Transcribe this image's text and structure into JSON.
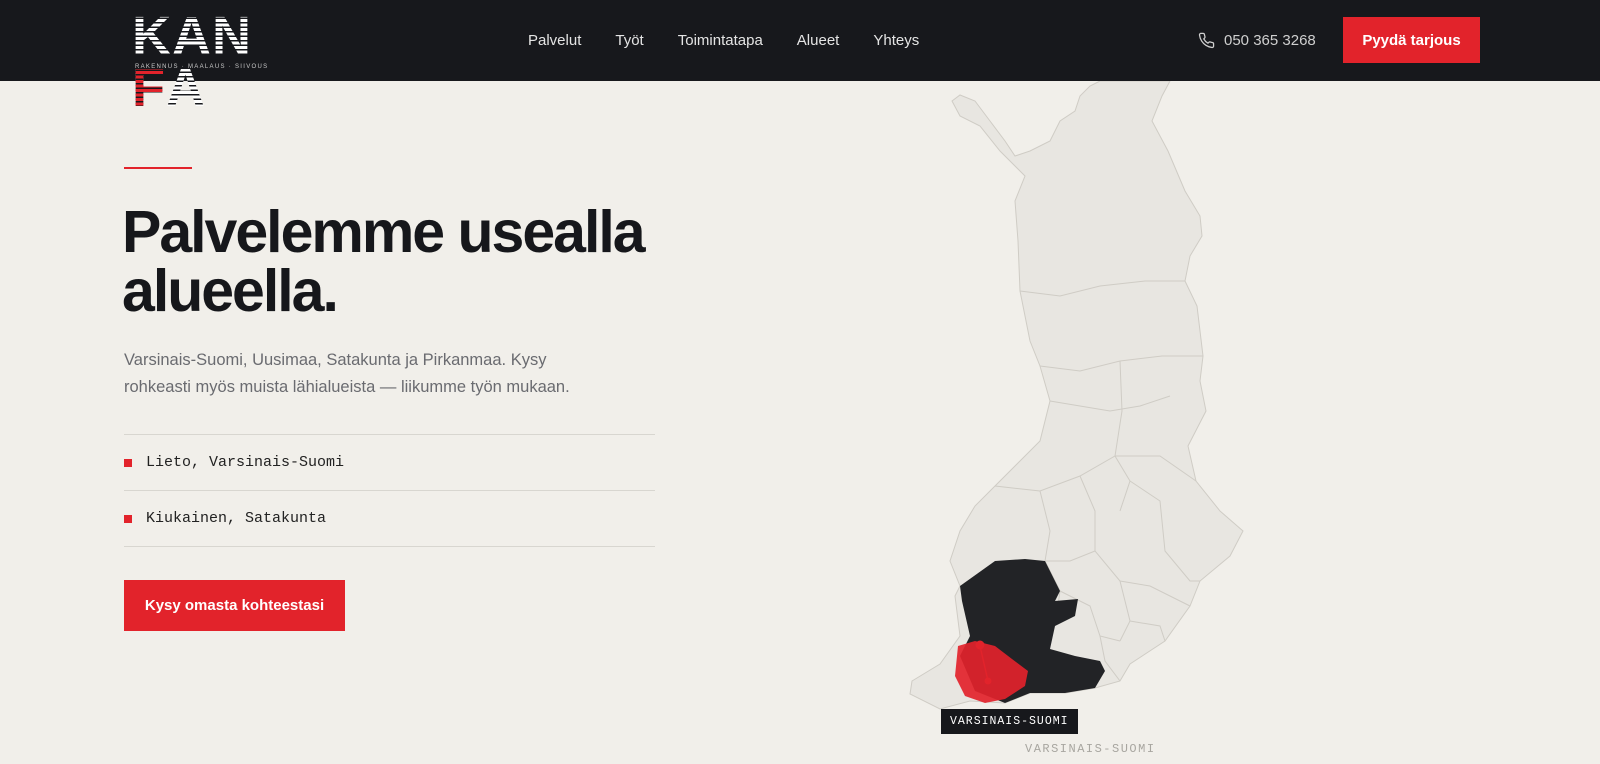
{
  "brand": {
    "logo_pre": "KAN",
    "logo_f": "F",
    "logo_post": "A",
    "tagline": "RAKENNUS · MAALAUS · SIIVOUS",
    "accent_color": "#e2232b",
    "dark_color": "#17181c"
  },
  "nav": {
    "items": [
      {
        "label": "Palvelut"
      },
      {
        "label": "Työt"
      },
      {
        "label": "Toimintatapa"
      },
      {
        "label": "Alueet"
      },
      {
        "label": "Yhteys"
      }
    ],
    "phone_icon": "phone-icon",
    "phone": "050 365 3268",
    "cta_label": "Pyydä tarjous"
  },
  "hero": {
    "title": "Palvelemme usealla alueella.",
    "description": "Varsinais-Suomi, Uusimaa, Satakunta ja Pirkanmaa. Kysy rohkeasti myös muista lähialueista — liikumme työn mukaan.",
    "locations": [
      {
        "label": "Lieto, Varsinais-Suomi"
      },
      {
        "label": "Kiukainen, Satakunta"
      }
    ],
    "cta_label": "Kysy omasta kohteestasi"
  },
  "map": {
    "highlight_tag": "VARSINAIS-SUOMI",
    "caption": "VARSINAIS-SUOMI",
    "region_color": "#e2232b",
    "active_color": "#222326",
    "base_color": "#e8e6e1"
  }
}
